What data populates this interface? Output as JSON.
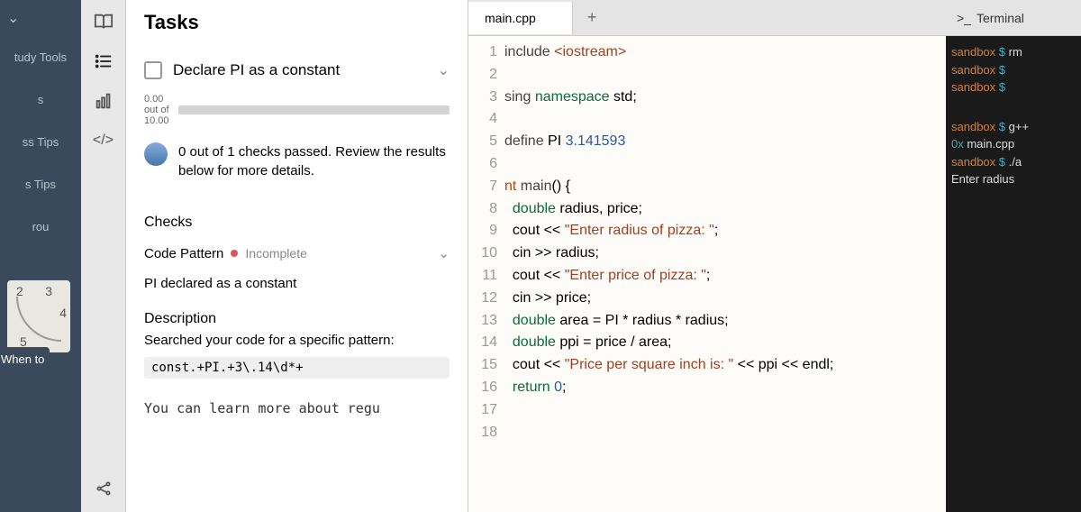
{
  "leftNav": {
    "items": [
      "tudy Tools",
      "s",
      "ss Tips",
      "s Tips",
      "rou"
    ],
    "whenTo": "When to"
  },
  "tasks": {
    "header": "Tasks",
    "taskTitle": "Declare  PI  as a constant",
    "progress": {
      "top": "0.00",
      "mid": "out of",
      "bot": "10.00"
    },
    "resultText": "0 out of 1 checks passed. Review the results below for more details.",
    "checksHeading": "Checks",
    "checkItems": [
      {
        "label": "Code Pattern",
        "status": "Incomplete"
      }
    ],
    "piLine": "PI  declared as a constant",
    "descHeading": "Description",
    "descText": "Searched your code for a specific pattern:",
    "descCode": "const.+PI.+3\\.14\\d*+",
    "learnMore": "You can learn more about regu"
  },
  "editor": {
    "tabName": "main.cpp",
    "lines": [
      {
        "n": 1,
        "html": "<span class='pp'>include</span> <span class='str'>&lt;iostream&gt;</span>"
      },
      {
        "n": 2,
        "html": ""
      },
      {
        "n": 3,
        "html": "<span class='pp'>sing</span> <span class='kw'>namespace</span> std;"
      },
      {
        "n": 4,
        "html": ""
      },
      {
        "n": 5,
        "html": "<span class='pp'>define</span> PI <span class='num'>3.141593</span>"
      },
      {
        "n": 6,
        "html": ""
      },
      {
        "n": 7,
        "html": "<span class='ty'>nt</span> <span class='fn'>main</span>() {"
      },
      {
        "n": 8,
        "html": "  <span class='kw'>double</span> radius, price;"
      },
      {
        "n": 9,
        "html": "  cout &lt;&lt; <span class='str'>\"Enter radius of pizza: \"</span>;"
      },
      {
        "n": 10,
        "html": "  cin &gt;&gt; radius;"
      },
      {
        "n": 11,
        "html": "  cout &lt;&lt; <span class='str'>\"Enter price of pizza: \"</span>;"
      },
      {
        "n": 12,
        "html": "  cin &gt;&gt; price;"
      },
      {
        "n": 13,
        "html": "  <span class='kw'>double</span> area = PI * radius * radius;"
      },
      {
        "n": 14,
        "html": "  <span class='kw'>double</span> ppi = price / area;"
      },
      {
        "n": 15,
        "html": "  cout &lt;&lt; <span class='str'>\"Price per square inch is: \"</span> &lt;&lt; ppi &lt;&lt; endl;"
      },
      {
        "n": 16,
        "html": "  <span class='kw'>return</span> <span class='num'>0</span>;"
      },
      {
        "n": 17,
        "html": ""
      },
      {
        "n": 18,
        "html": ""
      }
    ]
  },
  "terminal": {
    "header": "Terminal",
    "lines": [
      "sandbox $ rm",
      "sandbox $",
      "sandbox $",
      "",
      "sandbox $ g++",
      "0x main.cpp",
      "sandbox $ ./a",
      "Enter radius"
    ]
  }
}
